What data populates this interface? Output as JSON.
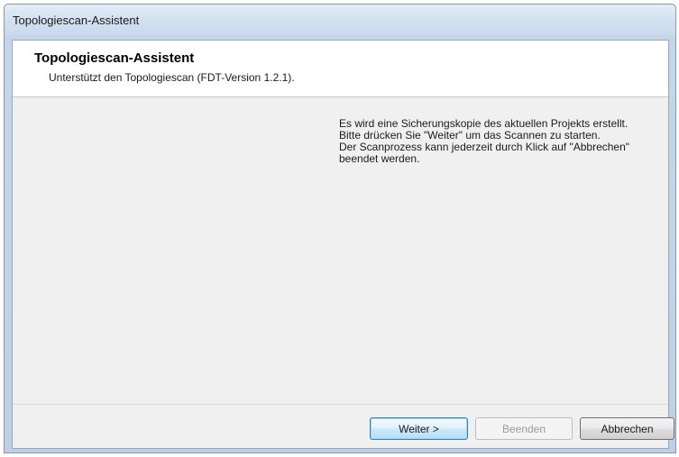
{
  "window": {
    "title": "Topologiescan-Assistent"
  },
  "header": {
    "title": "Topologiescan-Assistent",
    "subtitle": "Unterstützt den Topologiescan (FDT-Version 1.2.1)."
  },
  "content": {
    "info_lines": [
      "Es wird eine Sicherungskopie des aktuellen Projekts erstellt.",
      "Bitte drücken Sie \"Weiter\" um das Scannen zu starten.",
      "Der Scanprozess kann jederzeit durch Klick auf \"Abbrechen\"",
      "beendet werden."
    ]
  },
  "buttons": {
    "next_label": "Weiter >",
    "finish_label": "Beenden",
    "cancel_label": "Abbrechen"
  }
}
